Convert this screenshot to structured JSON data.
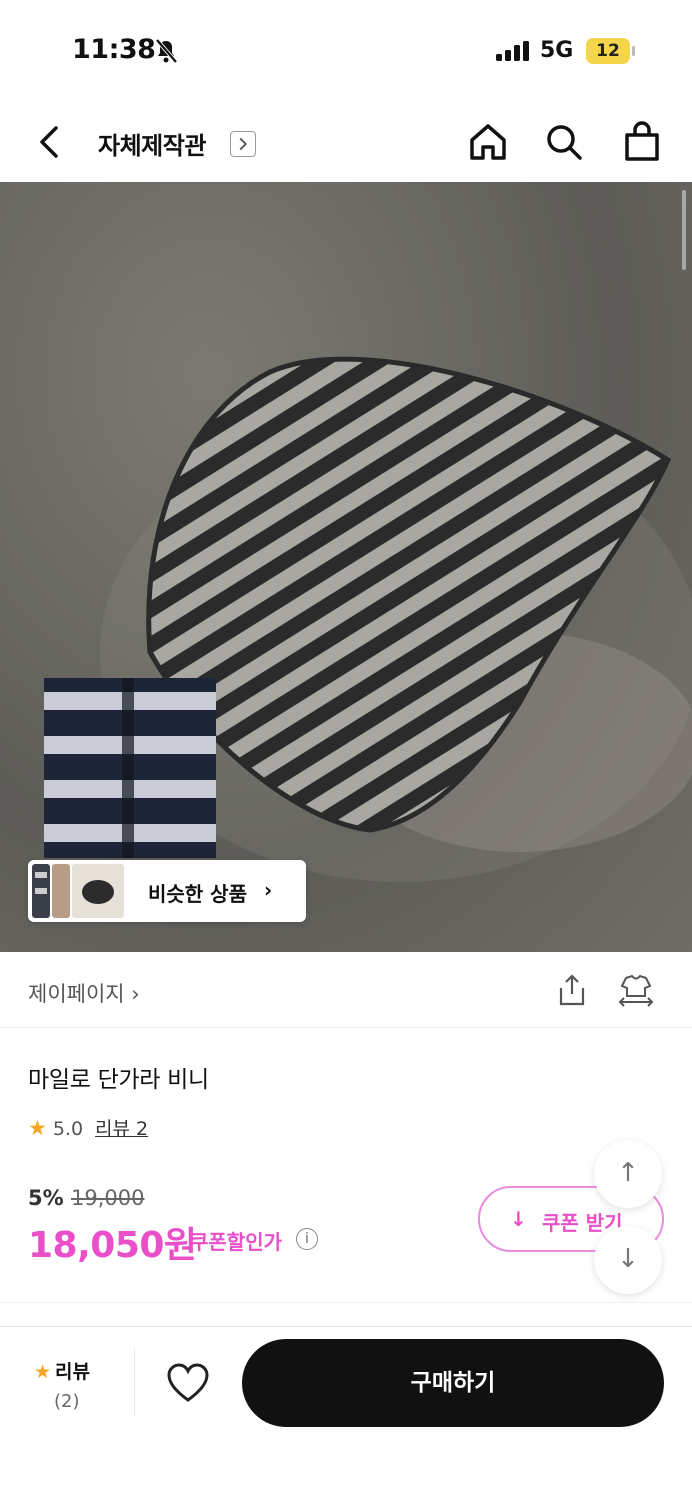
{
  "status_bar": {
    "time": "11:38",
    "network": "5G",
    "battery": "12"
  },
  "nav": {
    "title": "자체제작관"
  },
  "hero": {
    "similar_label": "비슷한 상품",
    "similar_arrow": "›"
  },
  "brand": {
    "name": "제이페이지 ›"
  },
  "product": {
    "name": "마일로 단가라 비니",
    "rating": "5.0",
    "review_link": "리뷰 2",
    "discount": "5%",
    "original_price": "19,000",
    "price": "18,050원",
    "price_tag": "쿠폰할인가",
    "info": "i"
  },
  "coupon": {
    "icon": "↓",
    "label": "쿠폰 받기"
  },
  "fab": {
    "up": "↑",
    "down": "↓"
  },
  "bottom_bar": {
    "review_label": "리뷰",
    "review_count": "(2)",
    "buy_label": "구매하기"
  },
  "colors": {
    "accent": "#e84fc9",
    "star": "#f5a623",
    "buy_button": "#111111"
  }
}
